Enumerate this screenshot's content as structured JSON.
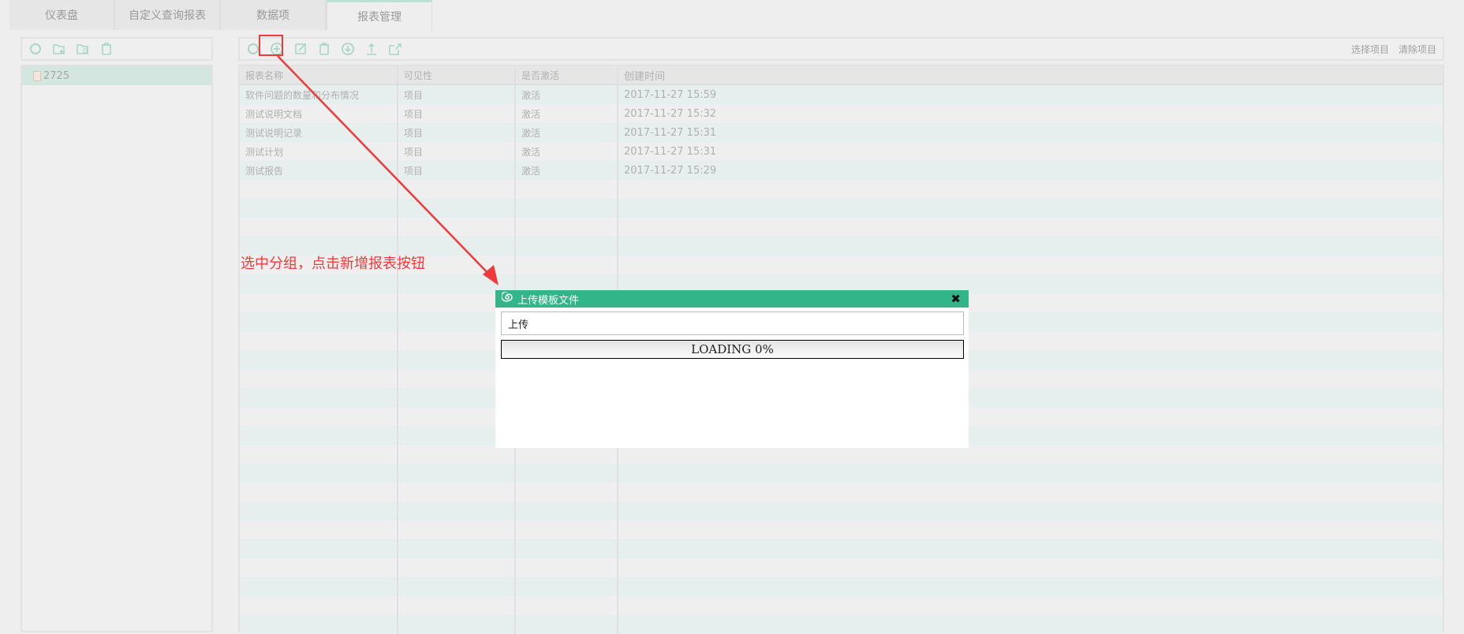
{
  "tabs": [
    {
      "label": "仪表盘"
    },
    {
      "label": "自定义查询报表"
    },
    {
      "label": "数据项"
    },
    {
      "label": "报表管理",
      "active": true
    }
  ],
  "left_toolbar": {
    "icons": [
      "refresh-icon",
      "add-folder-icon",
      "edit-folder-icon",
      "delete-icon"
    ]
  },
  "tree": {
    "nodes": [
      {
        "label": "2725",
        "selected": true
      }
    ]
  },
  "right_toolbar": {
    "icons": [
      "refresh-icon",
      "add-report-icon",
      "edit-icon",
      "delete-icon",
      "download-icon",
      "upload-icon",
      "export-icon"
    ],
    "select_project": "选择项目",
    "clear_project": "清除项目"
  },
  "table": {
    "columns": [
      "报表名称",
      "可见性",
      "是否激活",
      "创建时间"
    ],
    "rows": [
      [
        "软件问题的数量和分布情况",
        "项目",
        "激活",
        "2017-11-27 15:59"
      ],
      [
        "测试说明文档",
        "项目",
        "激活",
        "2017-11-27 15:32"
      ],
      [
        "测试说明记录",
        "项目",
        "激活",
        "2017-11-27 15:31"
      ],
      [
        "测试计划",
        "项目",
        "激活",
        "2017-11-27 15:31"
      ],
      [
        "测试报告",
        "项目",
        "激活",
        "2017-11-27 15:29"
      ]
    ]
  },
  "annotation": {
    "text": "选中分组，点击新增报表按钮",
    "color": "#f03a3a"
  },
  "dialog": {
    "title": "上传模板文件",
    "upload_label": "上传",
    "loading_text": "LOADING 0%",
    "progress_percent": 0,
    "accent": "#33b58a"
  }
}
